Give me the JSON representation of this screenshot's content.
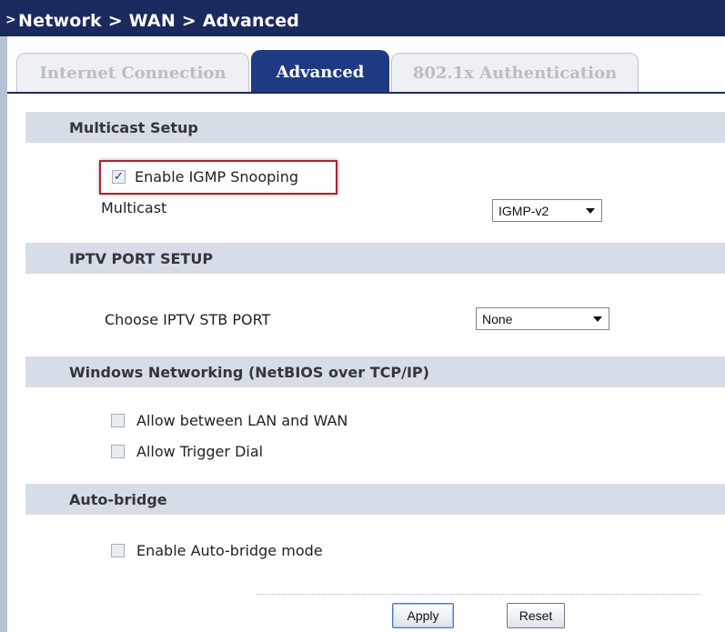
{
  "breadcrumb": {
    "arrow": ">",
    "text": "Network > WAN > Advanced"
  },
  "tabs": [
    {
      "label": "Internet Connection",
      "active": false
    },
    {
      "label": "Advanced",
      "active": true
    },
    {
      "label": "802.1x Authentication",
      "active": false
    }
  ],
  "multicast": {
    "header": "Multicast Setup",
    "igmp_snooping_label": "Enable IGMP Snooping",
    "igmp_snooping_checked": true,
    "multicast_label": "Multicast",
    "multicast_value": "IGMP-v2"
  },
  "iptv": {
    "header": "IPTV PORT SETUP",
    "stb_port_label": "Choose IPTV STB PORT",
    "stb_port_value": "None"
  },
  "windows_networking": {
    "header": "Windows Networking (NetBIOS over TCP/IP)",
    "allow_lan_wan_label": "Allow between LAN and WAN",
    "allow_lan_wan_checked": false,
    "allow_trigger_dial_label": "Allow Trigger Dial",
    "allow_trigger_dial_checked": false
  },
  "auto_bridge": {
    "header": "Auto-bridge",
    "enable_label": "Enable Auto-bridge mode",
    "enable_checked": false
  },
  "buttons": {
    "apply": "Apply",
    "reset": "Reset"
  },
  "colors": {
    "title_bar": "#1b2a5e",
    "active_tab": "#1f3a83",
    "section_bg": "#d7dde6",
    "highlight": "#b2212b"
  },
  "glyphs": {
    "check": "✓",
    "unchecked": ""
  }
}
